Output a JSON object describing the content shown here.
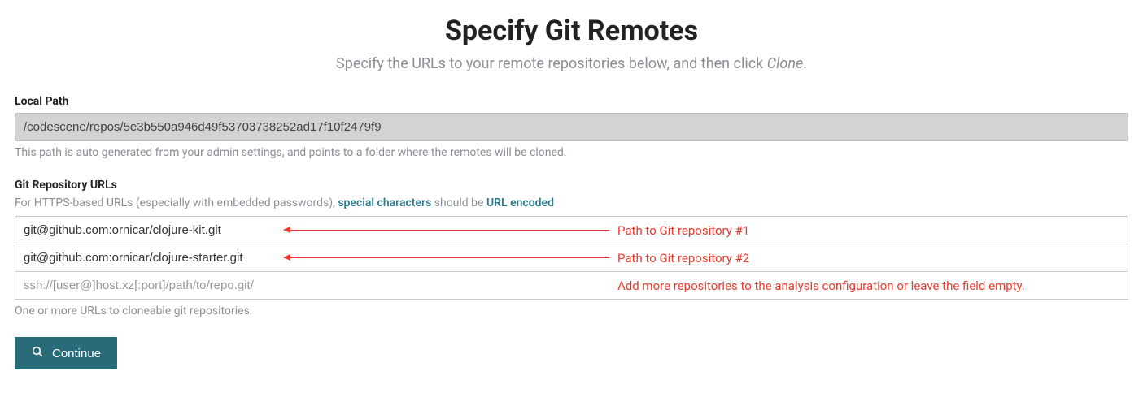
{
  "header": {
    "title": "Specify Git Remotes",
    "subtitle_pre": "Specify the URLs to your remote repositories below, and then click ",
    "subtitle_em": "Clone",
    "subtitle_post": "."
  },
  "local_path": {
    "label": "Local Path",
    "value": "/codescene/repos/5e3b550a946d49f53703738252ad17f10f2479f9",
    "help": "This path is auto generated from your admin settings, and points to a folder where the remotes will be cloned."
  },
  "git_urls": {
    "label": "Git Repository URLs",
    "help_pre": "For HTTPS-based URLs (especially with embedded passwords), ",
    "link1": "special characters",
    "help_mid": " should be ",
    "link2": "URL encoded",
    "rows": [
      {
        "value": "git@github.com:ornicar/clojure-kit.git",
        "annotation": "Path to Git repository #1"
      },
      {
        "value": "git@github.com:ornicar/clojure-starter.git",
        "annotation": "Path to Git repository #2"
      },
      {
        "value": "",
        "placeholder": "ssh://[user@]host.xz[:port]/path/to/repo.git/",
        "annotation": "Add more repositories to the analysis configuration or leave the field empty."
      }
    ],
    "footer_help": "One or more URLs to cloneable git repositories."
  },
  "actions": {
    "continue_label": "Continue"
  },
  "colors": {
    "accent": "#2a6b7a",
    "annotation": "#e63b2e",
    "link": "#2a7a8c"
  }
}
